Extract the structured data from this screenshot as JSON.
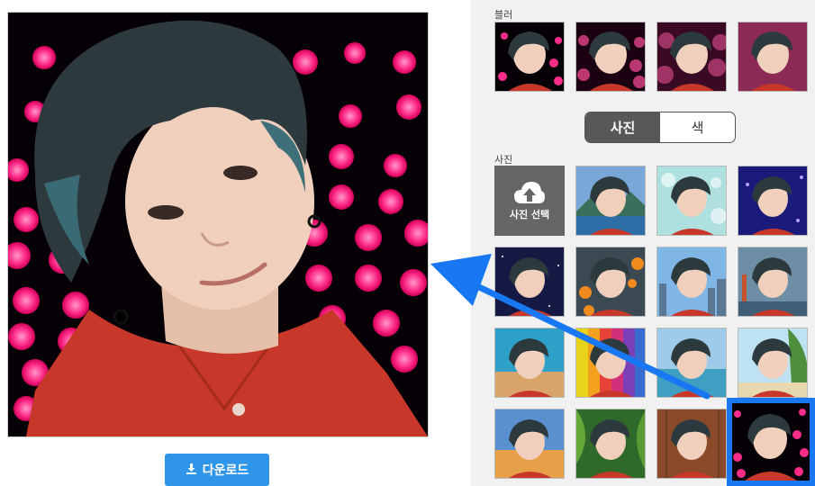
{
  "download": {
    "label": "다운로드",
    "icon": "download-icon"
  },
  "blur_section": {
    "label": "블러"
  },
  "toggle": {
    "photo": "사진",
    "color": "색",
    "selected": "사진"
  },
  "photo_section": {
    "label": "사진",
    "upload_label": "사진 선택",
    "upload_icon": "cloud-upload-icon"
  },
  "colors": {
    "accent": "#1877f2",
    "button_blue": "#2f95e8",
    "pink_dots": "#ff2d8a"
  }
}
